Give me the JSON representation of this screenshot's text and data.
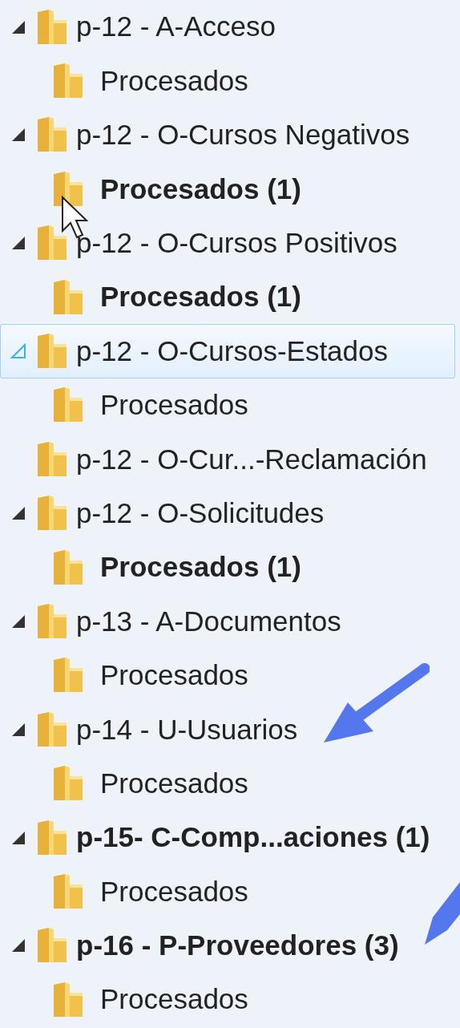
{
  "folders": [
    {
      "label": "p-12 - A-Acceso",
      "bold": false,
      "expanded": true,
      "selected": false,
      "children": [
        {
          "label": "Procesados",
          "bold": false
        }
      ]
    },
    {
      "label": "p-12 - O-Cursos Negativos",
      "bold": false,
      "expanded": true,
      "selected": false,
      "children": [
        {
          "label": "Procesados (1)",
          "bold": true
        }
      ]
    },
    {
      "label": "p-12 - O-Cursos Positivos",
      "bold": false,
      "expanded": true,
      "selected": false,
      "children": [
        {
          "label": "Procesados (1)",
          "bold": true
        }
      ]
    },
    {
      "label": "p-12 - O-Cursos-Estados",
      "bold": false,
      "expanded": true,
      "selected": true,
      "children": [
        {
          "label": "Procesados",
          "bold": false
        }
      ]
    },
    {
      "label": "p-12 - O-Cur...-Reclamación",
      "bold": false,
      "selected": false
    },
    {
      "label": "p-12 - O-Solicitudes",
      "bold": false,
      "expanded": true,
      "selected": false,
      "children": [
        {
          "label": "Procesados (1)",
          "bold": true
        }
      ]
    },
    {
      "label": "p-13 - A-Documentos",
      "bold": false,
      "expanded": true,
      "selected": false,
      "children": [
        {
          "label": "Procesados",
          "bold": false
        }
      ]
    },
    {
      "label": "p-14 - U-Usuarios",
      "bold": false,
      "expanded": true,
      "selected": false,
      "children": [
        {
          "label": "Procesados",
          "bold": false
        }
      ]
    },
    {
      "label": "p-15- C-Comp...aciones (1)",
      "bold": true,
      "expanded": true,
      "selected": false,
      "children": [
        {
          "label": "Procesados",
          "bold": false
        }
      ]
    },
    {
      "label": "p-16 - P-Proveedores (3)",
      "bold": true,
      "expanded": true,
      "selected": false,
      "children": [
        {
          "label": "Procesados",
          "bold": false
        }
      ]
    }
  ]
}
